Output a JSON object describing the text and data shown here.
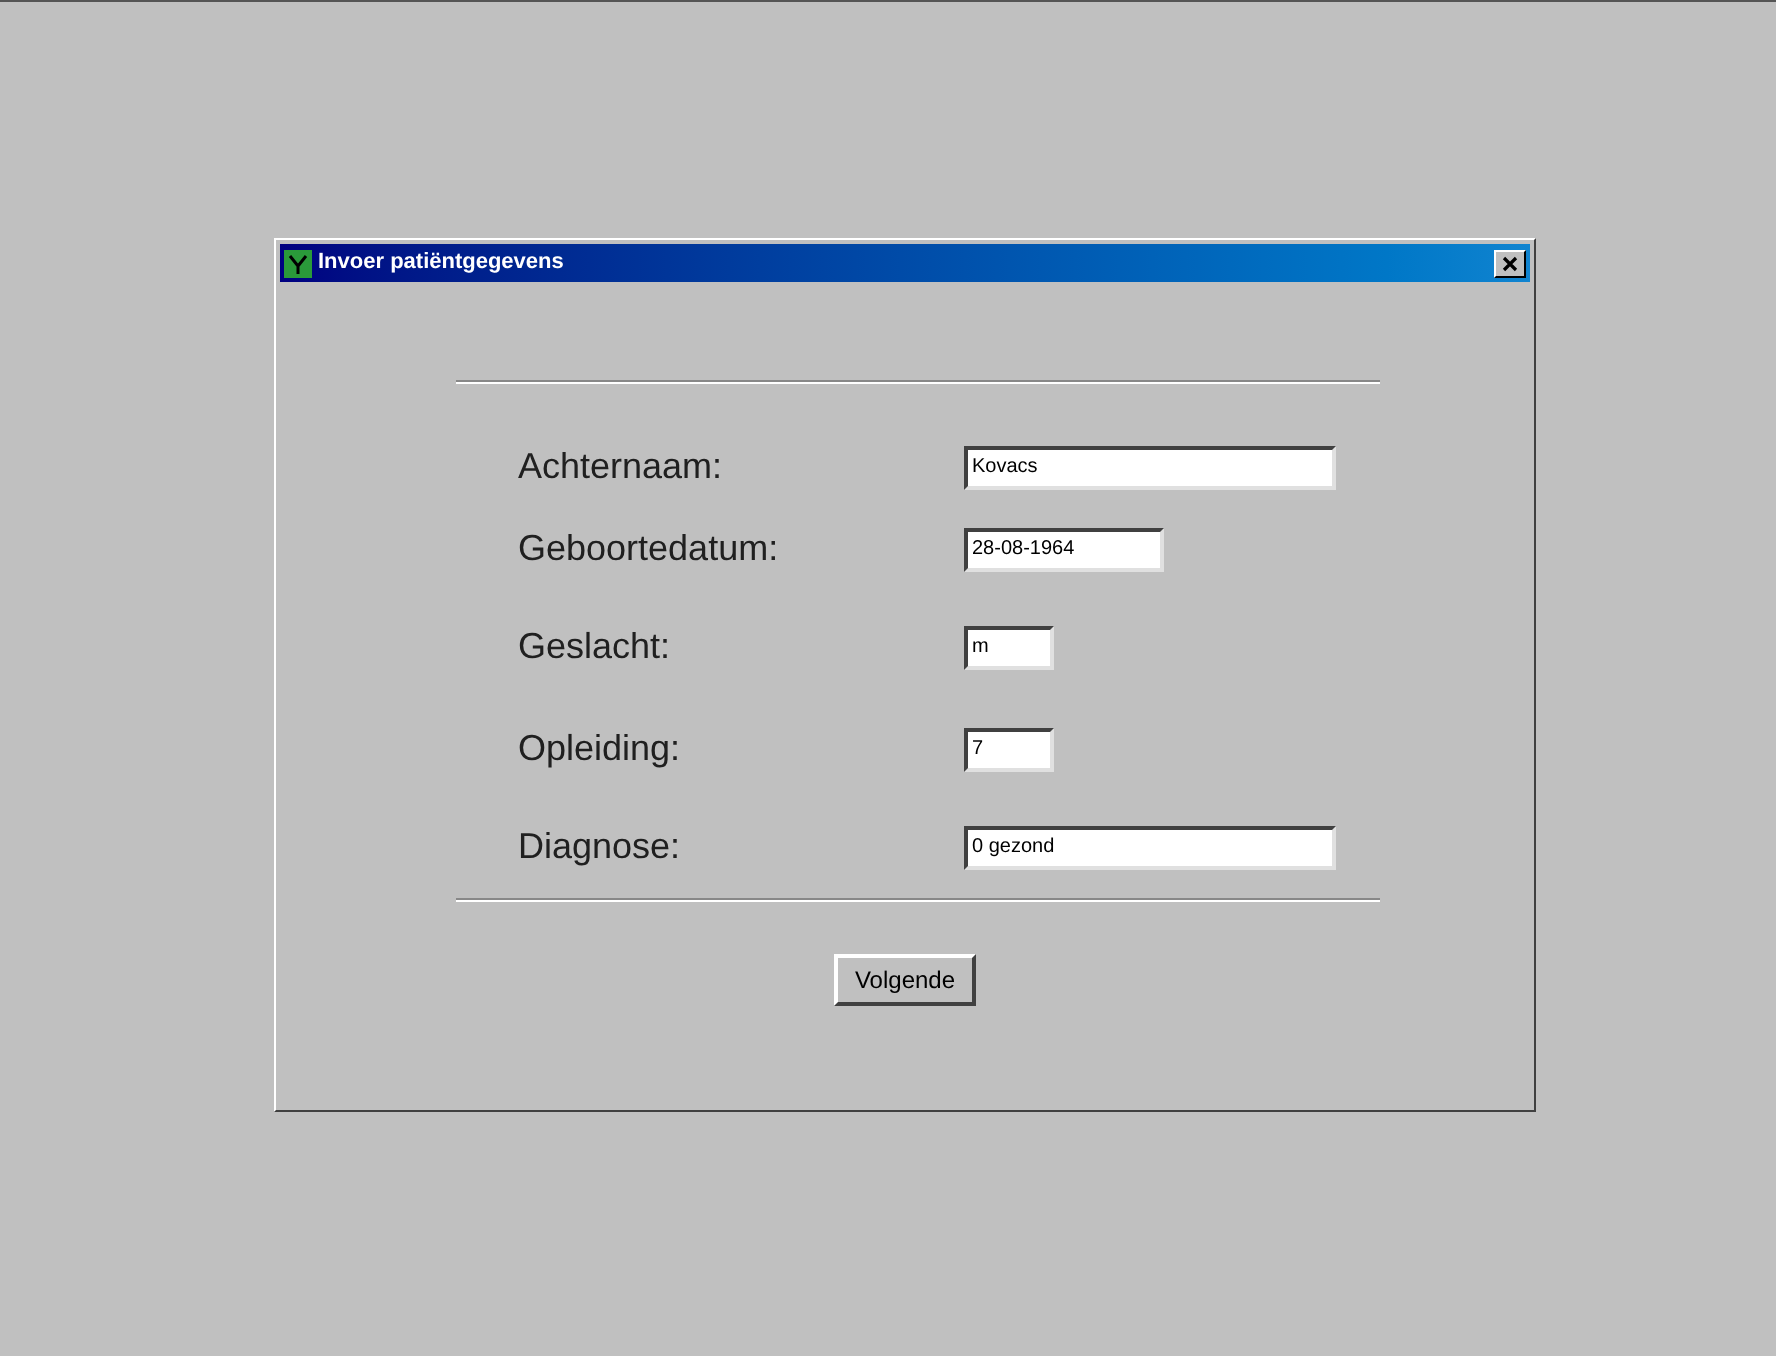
{
  "window": {
    "title": "Invoer patiëntgegevens"
  },
  "fields": [
    {
      "label": "Achternaam:",
      "value": "Kovacs",
      "kind": "long"
    },
    {
      "label": "Geboortedatum:",
      "value": "28-08-1964",
      "kind": "medium"
    },
    {
      "label": "Geslacht:",
      "value": "m",
      "kind": "short"
    },
    {
      "label": "Opleiding:",
      "value": "7",
      "kind": "short"
    },
    {
      "label": "Diagnose:",
      "value": "0 gezond",
      "kind": "long"
    }
  ],
  "button": "Volgende"
}
